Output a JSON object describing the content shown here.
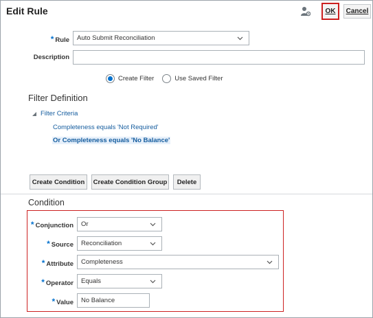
{
  "dialog": {
    "title": "Edit Rule",
    "ok_label": "OK",
    "cancel_label": "Cancel"
  },
  "rule": {
    "label": "Rule",
    "value": "Auto Submit Reconciliation"
  },
  "description": {
    "label": "Description",
    "value": ""
  },
  "filter_mode": {
    "options": [
      "Create Filter",
      "Use Saved Filter"
    ],
    "selected": "Create Filter"
  },
  "filter_definition": {
    "heading": "Filter Definition",
    "root": "Filter Criteria",
    "items": [
      "Completeness equals 'Not Required'",
      "Or Completeness equals 'No Balance'"
    ],
    "selected_item": "Or Completeness equals 'No Balance'"
  },
  "actions": {
    "create_condition": "Create Condition",
    "create_condition_group": "Create Condition Group",
    "delete": "Delete"
  },
  "condition": {
    "heading": "Condition",
    "conjunction": {
      "label": "Conjunction",
      "value": "Or"
    },
    "source": {
      "label": "Source",
      "value": "Reconciliation"
    },
    "attribute": {
      "label": "Attribute",
      "value": "Completeness"
    },
    "operator": {
      "label": "Operator",
      "value": "Equals"
    },
    "value": {
      "label": "Value",
      "value": "No Balance"
    }
  },
  "icons": {
    "person": "person-settings-icon",
    "chevron": "chevron-down-icon",
    "tree": "tree-expanded-icon"
  },
  "colors": {
    "accent": "#0572ce",
    "link": "#145c9e",
    "highlight_border": "#cc1f1f"
  }
}
